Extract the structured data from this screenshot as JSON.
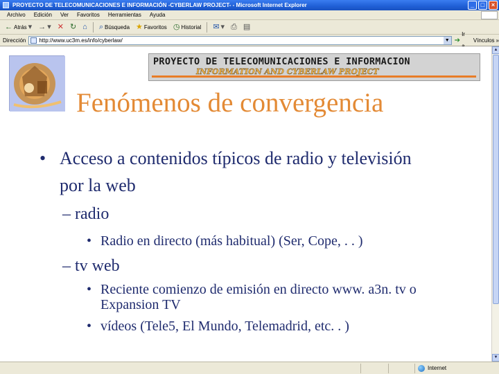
{
  "window": {
    "title": "PROYECTO DE TELECOMUNICACIONES E INFORMACIÓN -CYBERLAW PROJECT- - Microsoft Internet Explorer",
    "minimize": "_",
    "maximize": "□",
    "close": "×"
  },
  "menu": [
    "Archivo",
    "Edición",
    "Ver",
    "Favoritos",
    "Herramientas",
    "Ayuda"
  ],
  "toolbar": {
    "back_label": "Atrás",
    "search_label": "Búsqueda",
    "favorites_label": "Favoritos",
    "history_label": "Historial"
  },
  "address": {
    "label": "Dirección",
    "url": "http://www.uc3m.es/info/cyberlaw/",
    "go_label": "Ir a",
    "links_label": "Vínculos"
  },
  "banner": {
    "title": "PROYECTO DE TELECOMUNICACIONES E INFORMACION",
    "subtitle": "INFORMATION AND CYBERLAW PROJECT"
  },
  "slide": {
    "title": "Fenómenos de convergencia",
    "bullet1": {
      "marker": "•",
      "line1": "Acceso a contenidos típicos de radio y televisión",
      "line2": "por la web"
    },
    "sub_radio": {
      "label": "– radio",
      "item1": "Radio en directo (más habitual) (Ser, Cope, . . )"
    },
    "sub_tv": {
      "label": "– tv web",
      "item1_line1": "Reciente comienzo de emisión en directo www. a3n. tv o",
      "item1_line2": "Expansion TV",
      "item2": "vídeos (Tele5, El Mundo, Telemadrid, etc. . )"
    }
  },
  "status": {
    "zone_label": "Internet"
  },
  "colors": {
    "title_orange": "#e38a35",
    "body_navy": "#1f2b6e",
    "chrome": "#ece9d8",
    "titlebar_blue": "#1f5fd6"
  }
}
